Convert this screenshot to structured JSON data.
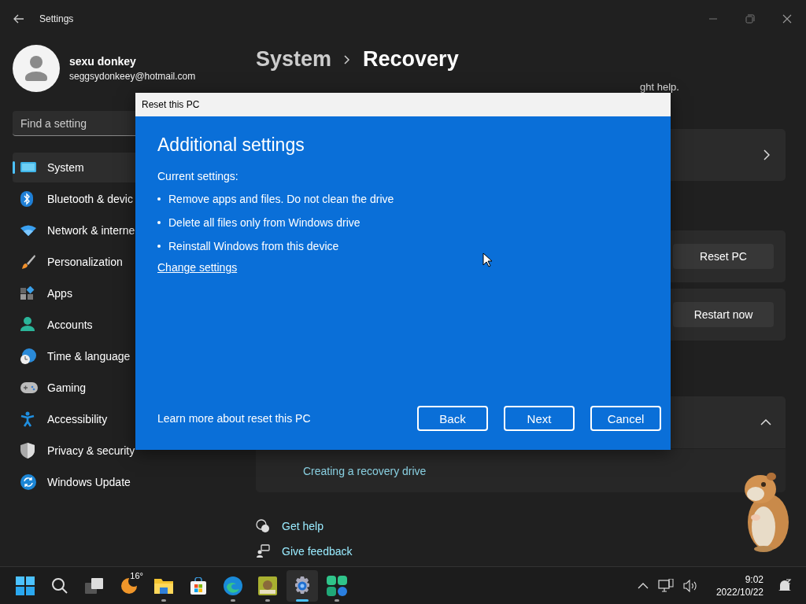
{
  "window": {
    "title": "Settings"
  },
  "user": {
    "name": "sexu donkey",
    "email": "seggsydonkeey@hotmail.com"
  },
  "search": {
    "placeholder": "Find a setting"
  },
  "nav": [
    {
      "kind": "system",
      "label": "System",
      "selected": true
    },
    {
      "kind": "bluetooth",
      "label": "Bluetooth & devic",
      "selected": false
    },
    {
      "kind": "network",
      "label": "Network & interne",
      "selected": false
    },
    {
      "kind": "personalization",
      "label": "Personalization",
      "selected": false
    },
    {
      "kind": "apps",
      "label": "Apps",
      "selected": false
    },
    {
      "kind": "accounts",
      "label": "Accounts",
      "selected": false
    },
    {
      "kind": "time",
      "label": "Time & language",
      "selected": false
    },
    {
      "kind": "gaming",
      "label": "Gaming",
      "selected": false
    },
    {
      "kind": "accessibility",
      "label": "Accessibility",
      "selected": false
    },
    {
      "kind": "privacy",
      "label": "Privacy & security",
      "selected": false
    },
    {
      "kind": "update",
      "label": "Windows Update",
      "selected": false
    }
  ],
  "breadcrumb": {
    "parent": "System",
    "current": "Recovery"
  },
  "description_fragment": "ght help.",
  "cards": [
    {
      "kind": "link"
    },
    {
      "kind": "button",
      "button": "Reset PC"
    },
    {
      "kind": "button",
      "button": "Restart now"
    },
    {
      "kind": "expander",
      "expanded": true,
      "children": [
        {
          "link": "Creating a recovery drive"
        }
      ]
    }
  ],
  "help_links": [
    {
      "kind": "help",
      "label": "Get help"
    },
    {
      "kind": "feedback",
      "label": "Give feedback"
    }
  ],
  "dialog": {
    "title": "Reset this PC",
    "heading": "Additional settings",
    "subheading": "Current settings:",
    "bullets": [
      "Remove apps and files. Do not clean the drive",
      "Delete all files only from Windows drive",
      "Reinstall Windows from this device"
    ],
    "change_link": "Change settings",
    "learn_more": "Learn more about reset this PC",
    "buttons": [
      {
        "label": "Back"
      },
      {
        "label": "Next"
      },
      {
        "label": "Cancel"
      }
    ]
  },
  "taskbar": {
    "apps": [
      {
        "kind": "start",
        "running": false,
        "selected": false
      },
      {
        "kind": "search",
        "running": false,
        "selected": false
      },
      {
        "kind": "taskview",
        "running": false,
        "selected": false
      },
      {
        "kind": "weather",
        "badge": "16°",
        "running": false,
        "selected": false
      },
      {
        "kind": "explorer",
        "running": true,
        "selected": false
      },
      {
        "kind": "store",
        "running": false,
        "selected": false
      },
      {
        "kind": "edge",
        "running": true,
        "selected": false
      },
      {
        "kind": "game",
        "running": true,
        "selected": false
      },
      {
        "kind": "settings",
        "running": true,
        "selected": true
      },
      {
        "kind": "clover",
        "running": true,
        "selected": false
      }
    ],
    "clock": {
      "time": "9:02",
      "date": "2022/10/22"
    }
  }
}
